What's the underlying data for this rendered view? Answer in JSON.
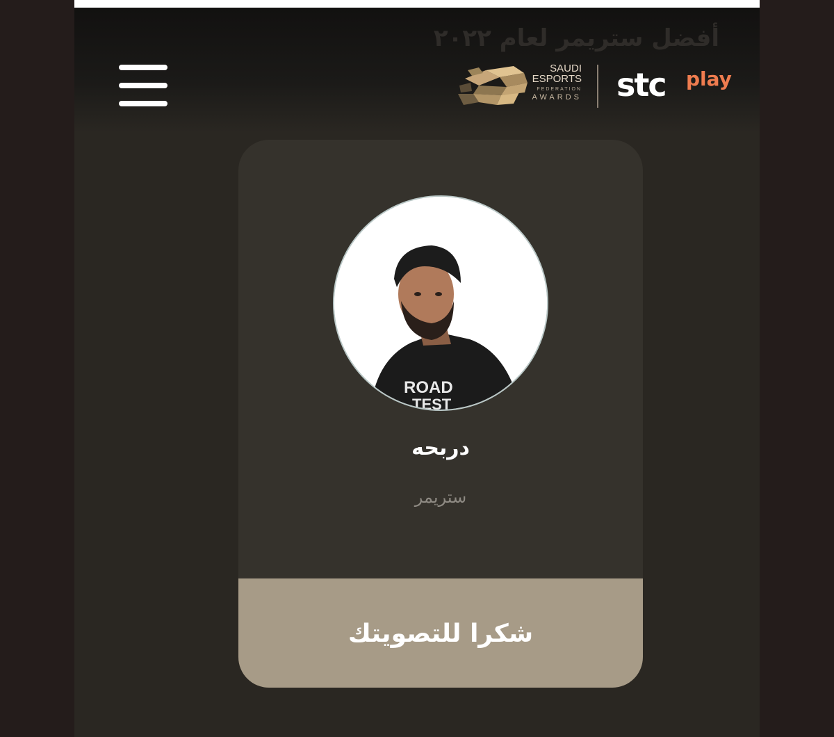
{
  "header": {
    "faded_title": "أفضل ستريمر لعام ٢٠٢٢",
    "menu_icon": "hamburger-menu-icon",
    "saef_logo": {
      "line1": "SAUDI",
      "line2": "ESPORTS",
      "line3": "FEDERATION",
      "line4": "AWARDS"
    },
    "stc_logo": {
      "stc": "stc",
      "play": "play"
    }
  },
  "card": {
    "name": "دربحه",
    "role": "ستريمر",
    "avatar_shirt_text_1": "ROAD",
    "avatar_shirt_text_2": "TEST",
    "vote_label": "شكرا للتصويتك"
  },
  "colors": {
    "page_bg": "#2a2722",
    "card_bg": "#35322c",
    "button_bg": "#a79b87",
    "play_orange": "#ef7c4f",
    "logo_gold": "#c7a679"
  }
}
